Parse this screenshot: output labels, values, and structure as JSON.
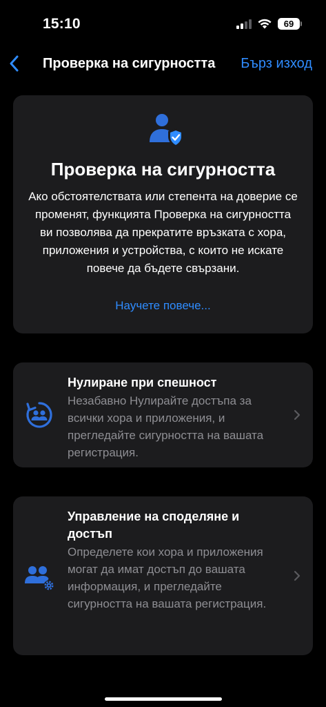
{
  "status_bar": {
    "time": "15:10",
    "battery_level": "69",
    "icons": [
      "cellular-signal-icon",
      "wifi-icon",
      "battery-icon"
    ]
  },
  "nav": {
    "back_icon": "chevron-left-icon",
    "title": "Проверка на сигурността",
    "quick_exit": "Бърз изход"
  },
  "hero": {
    "icon": "person-shield-icon",
    "title": "Проверка на сигурността",
    "description": "Ако обстоятелствата или степента на доверие се променят, функцията Проверка на сигурността ви позволява да прекратите връзката с хора, приложения и устройства, с които не искате повече да бъдете свързани.",
    "learn_more": "Научете повече..."
  },
  "options": [
    {
      "icon": "emergency-reset-icon",
      "title": "Нулиране при спешност",
      "description": "Незабавно Нулирайте достъпа за всички хора и приложения, и прегледайте сигурността на вашата регистрация."
    },
    {
      "icon": "manage-sharing-icon",
      "title": "Управление на споделяне и достъп",
      "description": "Определете кои хора и приложения могат да имат достъп до вашата информация, и прегледайте сигурността на вашата регистрация."
    }
  ],
  "colors": {
    "background": "#000000",
    "card": "#1c1c1e",
    "accent": "#2f8cff",
    "secondary_text": "#8e8e93",
    "icon_blue": "#2f6fdb"
  }
}
